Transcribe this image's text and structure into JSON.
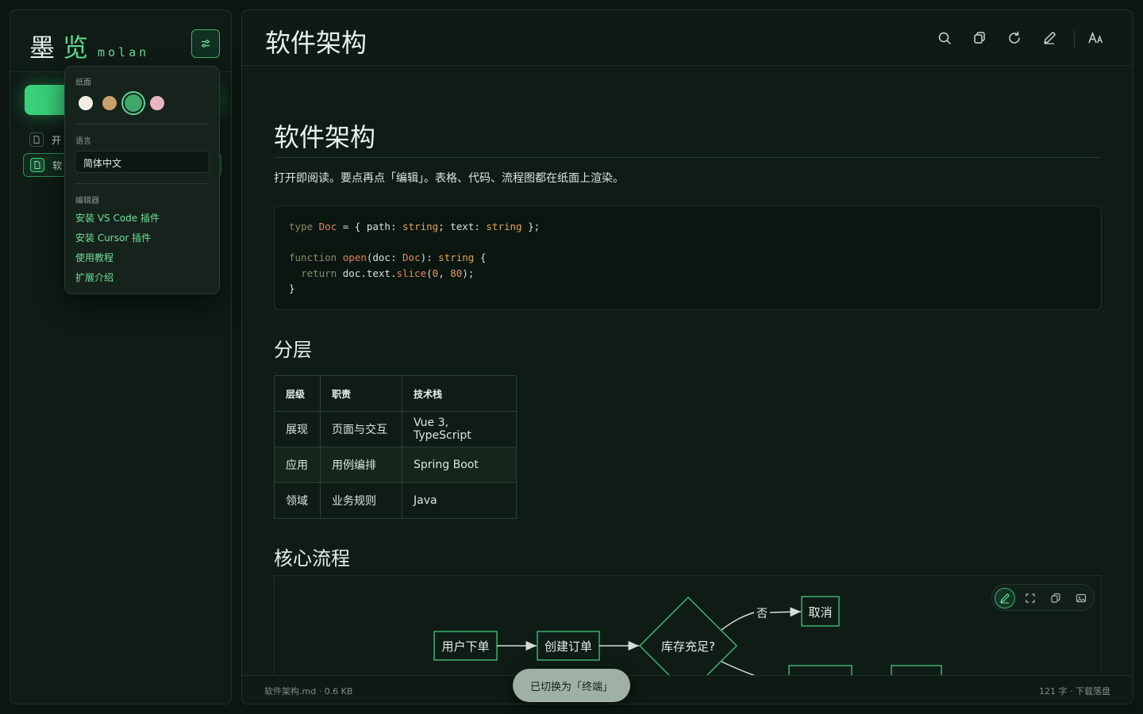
{
  "brand": {
    "name_part1": "墨",
    "name_part2": "览",
    "latin": "molan"
  },
  "sidebar": {
    "items": [
      {
        "label": "开"
      },
      {
        "label": "软"
      }
    ]
  },
  "popover": {
    "paper_label": "纸面",
    "paper_colors": [
      "#f3eee4",
      "#caa06a",
      "#3fa86a",
      "#e8b4bf"
    ],
    "language_label": "语言",
    "language_value": "简体中文",
    "editor_label": "编辑器",
    "links": [
      "安装 VS Code 插件",
      "安装 Cursor 插件",
      "使用教程",
      "扩展介绍"
    ]
  },
  "topbar": {
    "title": "软件架构"
  },
  "doc": {
    "h1": "软件架构",
    "intro": "打开即阅读。要点再点「编辑」。表格、代码、流程图都在纸面上渲染。",
    "code": {
      "l1_kw": "type",
      "l1_ty": "Doc",
      "l1_a": " = { path: ",
      "l1_s1": "string",
      "l1_b": "; text: ",
      "l1_s2": "string",
      "l1_c": " };",
      "l3_kw": "function",
      "l3_fn": "open",
      "l3_a": "(doc: ",
      "l3_ty": "Doc",
      "l3_b": "): ",
      "l3_s": "string",
      "l3_c": " {",
      "l4_kw": "return",
      "l4_a": " doc.text.",
      "l4_fn": "slice",
      "l4_b": "(",
      "l4_n1": "0",
      "l4_c": ", ",
      "l4_n2": "80",
      "l4_d": ");",
      "l5": "}"
    },
    "h2_layers": "分层",
    "table": {
      "headers": [
        "层级",
        "职责",
        "技术栈"
      ],
      "rows": [
        [
          "展现",
          "页面与交互",
          "Vue 3, TypeScript"
        ],
        [
          "应用",
          "用例编排",
          "Spring Boot"
        ],
        [
          "领域",
          "业务规则",
          "Java"
        ]
      ]
    },
    "h2_flow": "核心流程",
    "flow": {
      "n1": "用户下单",
      "n2": "创建订单",
      "decision": "库存充足?",
      "no_label": "否",
      "cancel": "取消"
    }
  },
  "status": {
    "left": "软件架构.md · 0.6 KB",
    "right": "121 字 · 下载落盘"
  },
  "toast": "已切换为「终端」"
}
